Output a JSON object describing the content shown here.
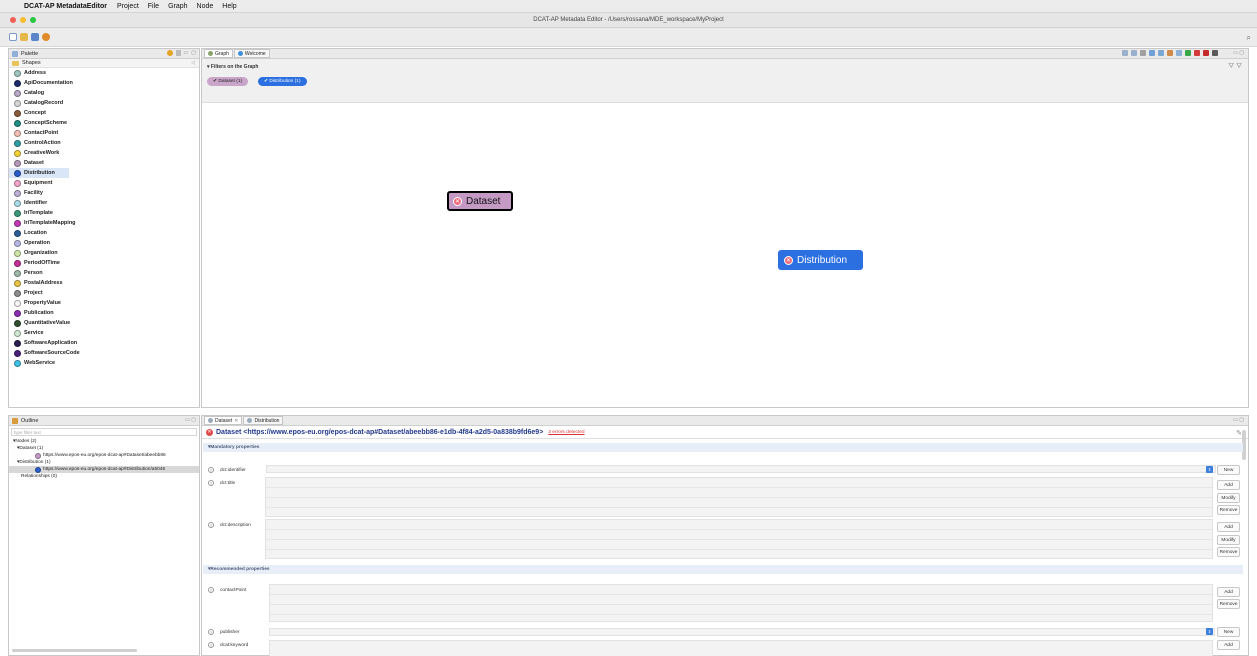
{
  "menubar": {
    "app_name": "DCAT-AP MetadataEditor",
    "items": [
      "Project",
      "File",
      "Graph",
      "Node",
      "Help"
    ]
  },
  "window": {
    "title": "DCAT-AP Metadata Editor - /Users/rossana/MDE_workspace/MyProject"
  },
  "palette": {
    "title": "Palette",
    "folder": "Shapes",
    "items": [
      {
        "label": "Address",
        "color": "#9fc7bf"
      },
      {
        "label": "ApiDocumentation",
        "color": "#1f2a6b"
      },
      {
        "label": "Catalog",
        "color": "#b9a8c6"
      },
      {
        "label": "CatalogRecord",
        "color": "#d8d8d8"
      },
      {
        "label": "Concept",
        "color": "#8a5a3c"
      },
      {
        "label": "ConceptScheme",
        "color": "#1f8f86"
      },
      {
        "label": "ContactPoint",
        "color": "#f2c0b4"
      },
      {
        "label": "ControlAction",
        "color": "#2f9fa6"
      },
      {
        "label": "CreativeWork",
        "color": "#f3d23a"
      },
      {
        "label": "Dataset",
        "color": "#b49ab8"
      },
      {
        "label": "Distribution",
        "color": "#2b5fc9"
      },
      {
        "label": "Equipment",
        "color": "#f2a6c8"
      },
      {
        "label": "Facility",
        "color": "#bfb0d6"
      },
      {
        "label": "Identifier",
        "color": "#a9dbe8"
      },
      {
        "label": "IriTemplate",
        "color": "#3a9a7a"
      },
      {
        "label": "IriTemplateMapping",
        "color": "#c33ab7"
      },
      {
        "label": "Location",
        "color": "#2b5f9a"
      },
      {
        "label": "Operation",
        "color": "#b8b8e6"
      },
      {
        "label": "Organization",
        "color": "#cfe6a6"
      },
      {
        "label": "PeriodOfTime",
        "color": "#c42f9a"
      },
      {
        "label": "Person",
        "color": "#9fb8a8"
      },
      {
        "label": "PostalAddress",
        "color": "#e9c547"
      },
      {
        "label": "Project",
        "color": "#8c8c8c"
      },
      {
        "label": "PropertyValue",
        "color": "#f7f7f7"
      },
      {
        "label": "Publication",
        "color": "#8d2fb0"
      },
      {
        "label": "QuantitativeValue",
        "color": "#2f4f2f"
      },
      {
        "label": "Service",
        "color": "#cfe8cf"
      },
      {
        "label": "SoftwareApplication",
        "color": "#2a1f4f"
      },
      {
        "label": "SoftwareSourceCode",
        "color": "#4a1f7a"
      },
      {
        "label": "WebService",
        "color": "#3fc2e6"
      }
    ],
    "selected": "Distribution"
  },
  "graph": {
    "tabs": [
      "Graph",
      "Welcome"
    ],
    "filters_title": "Filters on the Graph",
    "filter_pills": [
      {
        "label": "✔ Dataset (1)",
        "color": "#c9a6c9"
      },
      {
        "label": "✔ Distribution (1)",
        "color": "#2b6fe0"
      }
    ],
    "nodes": {
      "dataset": {
        "label": "Dataset",
        "color": "#c49ac4"
      },
      "distribution": {
        "label": "Distribution",
        "color": "#2b6fe0"
      }
    }
  },
  "outline": {
    "title": "Outline",
    "filter_placeholder": "type filter text",
    "tree": {
      "nodes": "Nodes (2)",
      "dataset_group": "Dataset (1)",
      "dataset_uri": "https://www.epos-eu.org/epos-dcat-ap#Dataset/abeebb86",
      "distribution_group": "Distribution (1)",
      "distribution_uri": "https://www.epos-eu.org/epos-dcat-ap#Distribution/a5046",
      "relationships": "Relationships (0)"
    }
  },
  "editor": {
    "tabs": [
      "Dataset",
      "Distribution"
    ],
    "title": "Dataset <https://www.epos-eu.org/epos-dcat-ap#Dataset/abeebb86-e1db-4f84-a2d5-0a838b9fd6e9>",
    "errors_link": "3 errors detected",
    "mandatory_section": "Mandatory properties",
    "recommended_section": "Recommended properties",
    "props": {
      "identifier": "dct:identifier",
      "title": "dct:title",
      "description": "dct:description",
      "contact": "contactPoint",
      "publisher": "publisher",
      "keyword": "dcat:keyword"
    },
    "buttons": {
      "new": "New",
      "add": "Add",
      "modify": "Modify",
      "remove": "Remove"
    }
  }
}
